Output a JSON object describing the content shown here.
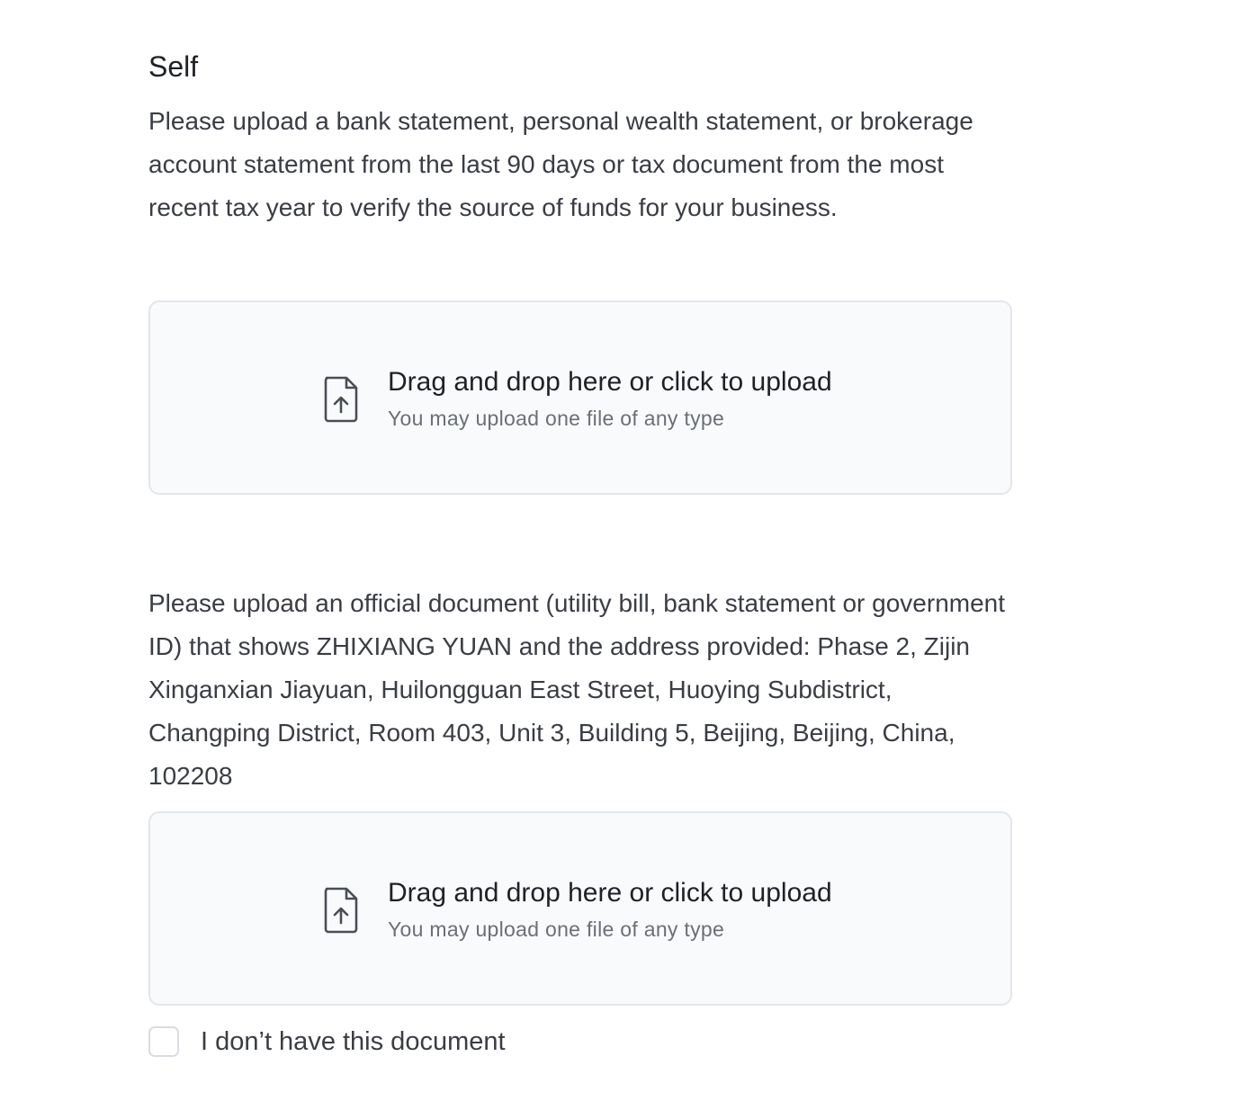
{
  "section": {
    "title": "Self"
  },
  "source_of_funds": {
    "description": "Please upload a bank statement, personal wealth statement, or brokerage account statement from the last 90 days or tax document from the most recent tax year to verify the source of funds for your business.",
    "upload": {
      "title": "Drag and drop here or click to upload",
      "subtitle": "You may upload one file of any type",
      "icon": "file-upload-icon"
    }
  },
  "proof_of_address": {
    "description": "Please upload an official document (utility bill, bank statement or government ID) that shows ZHIXIANG YUAN and the address provided: Phase 2, Zijin Xinganxian Jiayuan, Huilongguan East Street, Huoying Subdistrict, Changping District, Room 403, Unit 3, Building 5, Beijing, Beijing, China, 102208",
    "upload": {
      "title": "Drag and drop here or click to upload",
      "subtitle": "You may upload one file of any type",
      "icon": "file-upload-icon"
    },
    "no_document_checkbox": {
      "label": "I don’t have this document",
      "checked": false
    }
  },
  "colors": {
    "text_primary": "#1e2126",
    "text_body": "#3a3d44",
    "text_muted": "#6b6f76",
    "dropzone_bg": "#f9fafc",
    "dropzone_border": "#e3e6eb"
  }
}
